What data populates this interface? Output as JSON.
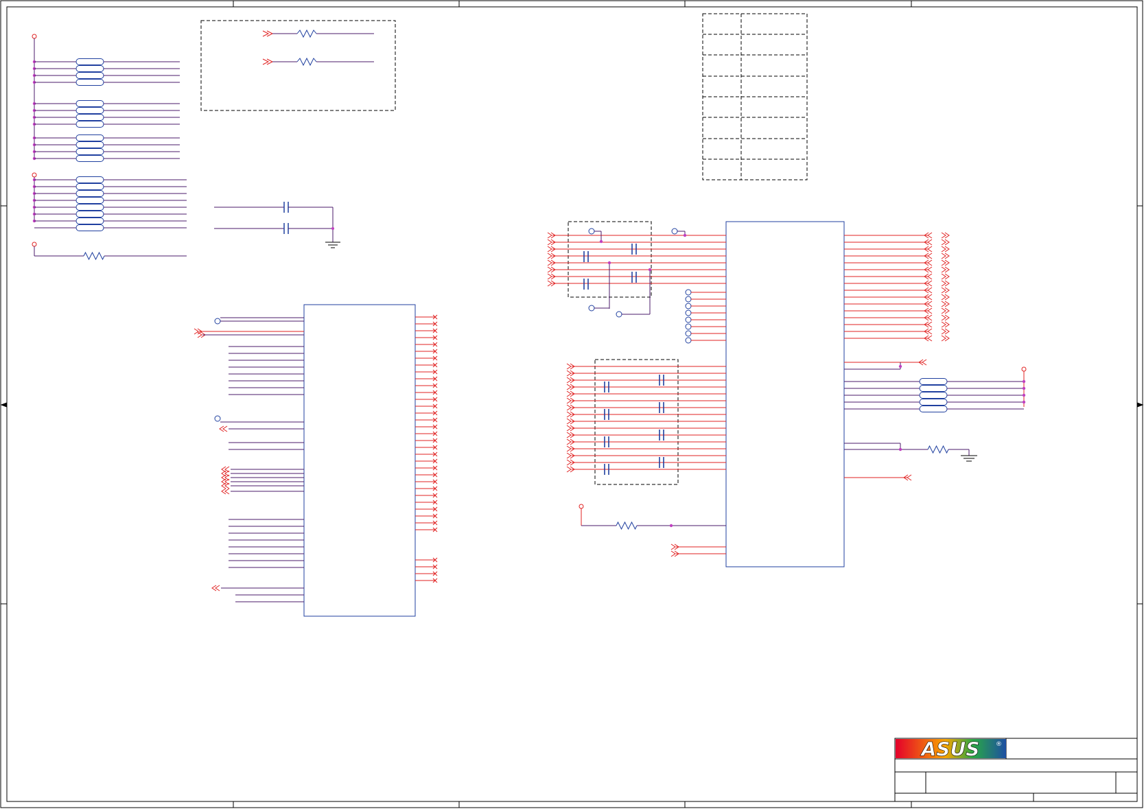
{
  "sheet": {
    "title_block": {
      "logo_text": "ASUS",
      "registered_mark": "®",
      "logo_colors": [
        "#e4002b",
        "#f7a400",
        "#2aa745",
        "#1d4fa3"
      ]
    }
  },
  "colors": {
    "net_wire": "#e02020",
    "bus_wire": "#4a1a6a",
    "component": "#1f3f9f",
    "junction": "#c040c0",
    "frame": "#000000"
  }
}
